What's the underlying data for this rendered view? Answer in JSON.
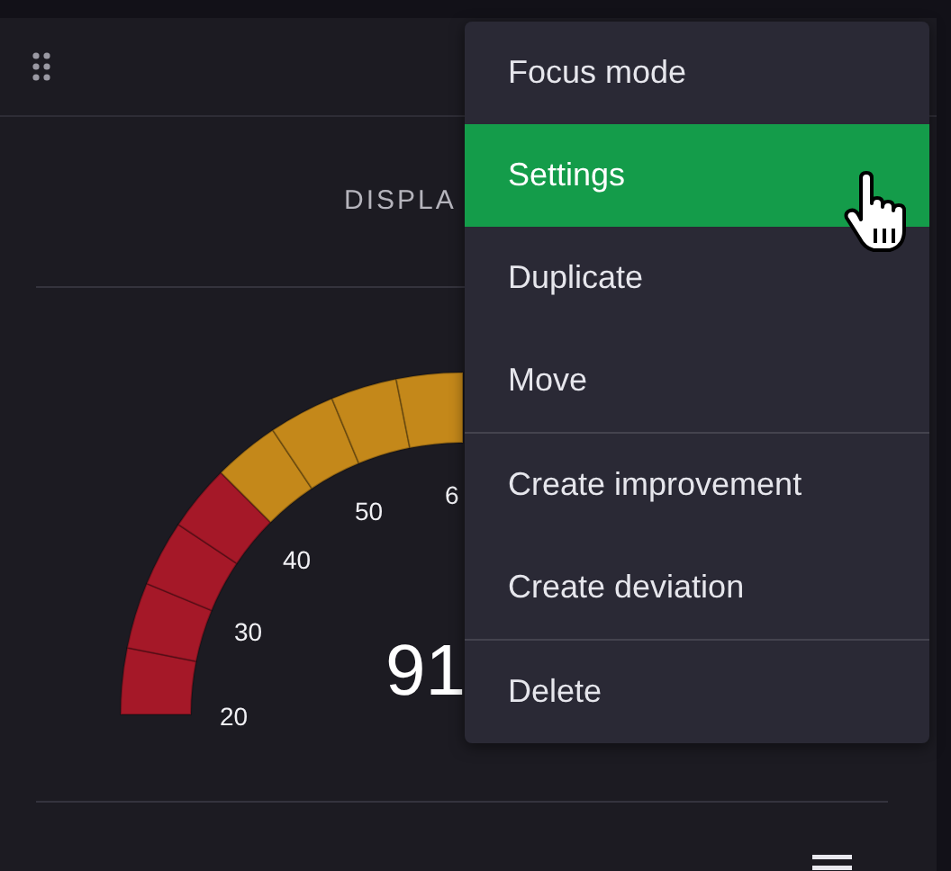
{
  "card": {
    "title": "DISPLA"
  },
  "gauge": {
    "tick_labels": [
      "20",
      "30",
      "40",
      "50",
      "6"
    ],
    "value": "91"
  },
  "menu": {
    "groups": [
      {
        "items": [
          {
            "label": "Focus mode",
            "selected": false
          },
          {
            "label": "Settings",
            "selected": true
          },
          {
            "label": "Duplicate",
            "selected": false
          },
          {
            "label": "Move",
            "selected": false
          }
        ]
      },
      {
        "items": [
          {
            "label": "Create improvement",
            "selected": false
          },
          {
            "label": "Create deviation",
            "selected": false
          }
        ]
      },
      {
        "items": [
          {
            "label": "Delete",
            "selected": false
          }
        ]
      }
    ]
  }
}
